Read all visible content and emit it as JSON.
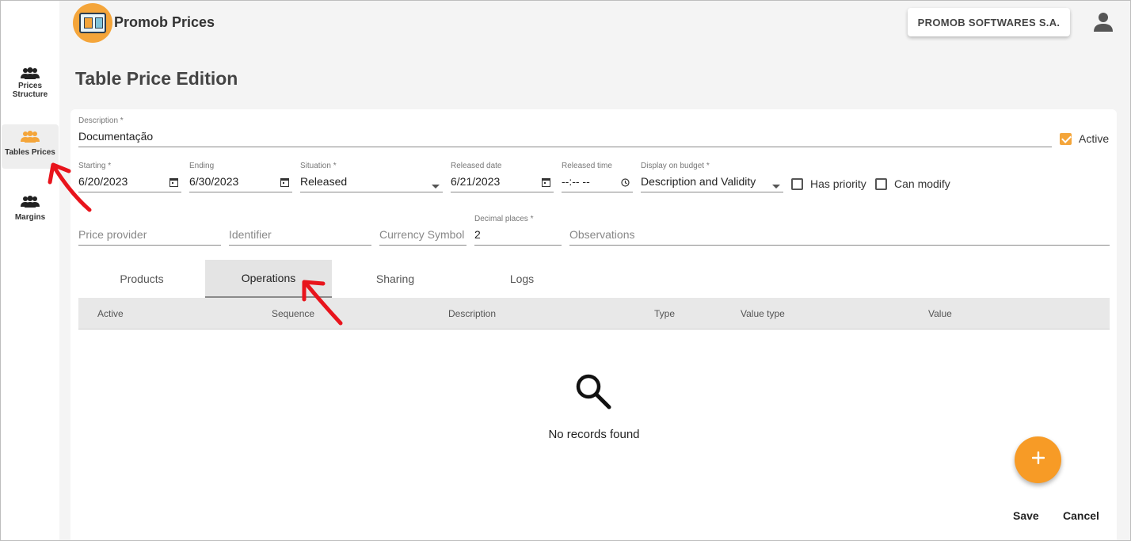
{
  "app": {
    "title": "Promob Prices"
  },
  "header": {
    "company": "PROMOB SOFTWARES S.A."
  },
  "sidebar": {
    "items": [
      {
        "label": "Prices Structure"
      },
      {
        "label": "Tables Prices"
      },
      {
        "label": "Margins"
      }
    ]
  },
  "page": {
    "title": "Table Price Edition"
  },
  "form": {
    "description": {
      "label": "Description *",
      "value": "Documentação"
    },
    "active": {
      "label": "Active",
      "checked": true
    },
    "starting": {
      "label": "Starting *",
      "value": "6/20/2023"
    },
    "ending": {
      "label": "Ending",
      "value": "6/30/2023"
    },
    "situation": {
      "label": "Situation *",
      "value": "Released"
    },
    "released_date": {
      "label": "Released date",
      "value": "6/21/2023"
    },
    "released_time": {
      "label": "Released time",
      "value": "--:-- --"
    },
    "display_on_budget": {
      "label": "Display on budget *",
      "value": "Description and Validity"
    },
    "has_priority": {
      "label": "Has priority",
      "checked": false
    },
    "can_modify": {
      "label": "Can modify",
      "checked": false
    },
    "price_provider": {
      "placeholder": "Price provider"
    },
    "identifier": {
      "placeholder": "Identifier"
    },
    "currency_symbol": {
      "placeholder": "Currency Symbol"
    },
    "decimal_places": {
      "label": "Decimal places *",
      "value": "2"
    },
    "observations": {
      "placeholder": "Observations"
    }
  },
  "tabs": [
    {
      "label": "Products"
    },
    {
      "label": "Operations",
      "active": true
    },
    {
      "label": "Sharing"
    },
    {
      "label": "Logs"
    }
  ],
  "table": {
    "columns": [
      "Active",
      "Sequence",
      "Description",
      "Type",
      "Value type",
      "Value"
    ],
    "empty_text": "No records found"
  },
  "actions": {
    "save": "Save",
    "cancel": "Cancel"
  },
  "colors": {
    "accent": "#f79b26",
    "annotation": "#e8141c"
  },
  "icons": {
    "nav": "people-icon",
    "user": "account-icon",
    "calendar": "calendar-icon",
    "clock": "clock-icon",
    "dropdown": "caret-down-icon",
    "search": "search-icon",
    "add": "plus-icon"
  }
}
